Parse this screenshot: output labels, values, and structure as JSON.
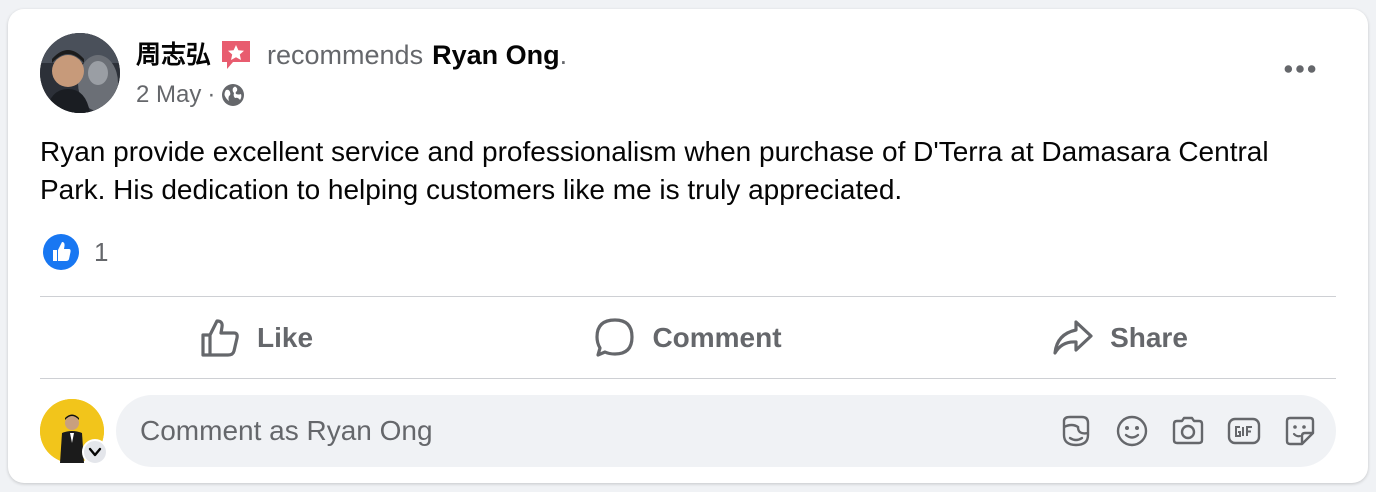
{
  "post": {
    "author_name": "周志弘",
    "recommends_text": "recommends",
    "target_name": "Ryan Ong",
    "period": ".",
    "date": "2 May",
    "separator": "·",
    "privacy_icon": "globe-icon",
    "body": "Ryan provide excellent service and professionalism when purchase of D'Terra at Damasara Central Park. His dedication to helping customers like me is truly appreciated.",
    "reaction_count": "1",
    "reaction_icon": "like-reaction-icon"
  },
  "actions": {
    "like_label": "Like",
    "comment_label": "Comment",
    "share_label": "Share"
  },
  "comment": {
    "placeholder": "Comment as Ryan Ong",
    "tools": [
      "avatar-sticker-icon",
      "emoji-icon",
      "camera-icon",
      "gif-icon",
      "sticker-icon"
    ]
  },
  "colors": {
    "accent_blue": "#1877f2",
    "recommend_badge": "#e85c6f",
    "secondary_text": "#65676b",
    "primary_text": "#050505",
    "card_bg": "#ffffff",
    "page_bg": "#f0f2f5"
  }
}
